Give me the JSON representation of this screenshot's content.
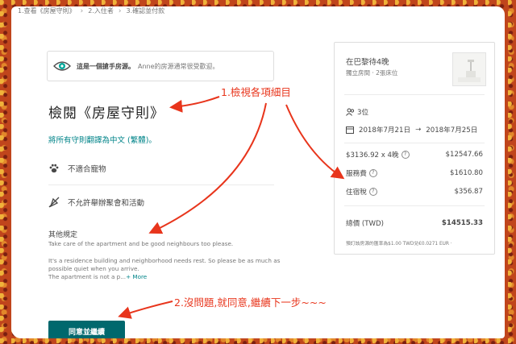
{
  "progress": {
    "steps": [
      {
        "num": "1.",
        "label": "查看《房屋守則》"
      },
      {
        "num": "2.",
        "label": "入住者"
      },
      {
        "num": "3.",
        "label": "確認並付款"
      }
    ]
  },
  "host_banner": {
    "bold": "這是一個搶手房源。",
    "text": "Anne的房源通常很受歡迎。"
  },
  "page_title": "檢閱《房屋守則》",
  "translate_link": "將所有守則翻譯為中文 (繁體)。",
  "rules": [
    {
      "icon": "paw-icon",
      "label": "不適合寵物"
    },
    {
      "icon": "party-icon",
      "label": "不允許舉辦聚會和活動"
    }
  ],
  "other_rules": {
    "title": "其他規定",
    "line1": "Take care of the apartment and be good neighbours too please.",
    "line2": "It's a residence building and neighborhood needs rest. So please be as much as possible quiet when you arrive.",
    "line3": "The apartment is not a p...",
    "more": "+ More"
  },
  "agree_button": "同意並繼續",
  "card": {
    "listing_title": "在巴黎待4晚",
    "listing_sub": "獨立房間 · 2張床位",
    "guests": "3位",
    "checkin": "2018年7月21日",
    "arrow": "→",
    "checkout": "2018年7月25日",
    "price_label": "$3136.92 x 4晚",
    "price_value": "$12547.66",
    "service_label": "服務費",
    "service_value": "$1610.80",
    "tax_label": "住宿稅",
    "tax_value": "$356.87",
    "total_label": "總價 (TWD)",
    "total_value": "$14515.33",
    "fx_note": "預訂該房源的匯率為$1.00 TWD兌€0.0271 EUR ·",
    "qmark": "?"
  },
  "annotations": {
    "a1": "1.檢視各項細目",
    "a2": "2.沒問題,就同意,繼續下一步~~~"
  },
  "colors": {
    "accent_teal": "#008489",
    "button_teal": "#00686d",
    "annotation_red": "#e8351c"
  }
}
